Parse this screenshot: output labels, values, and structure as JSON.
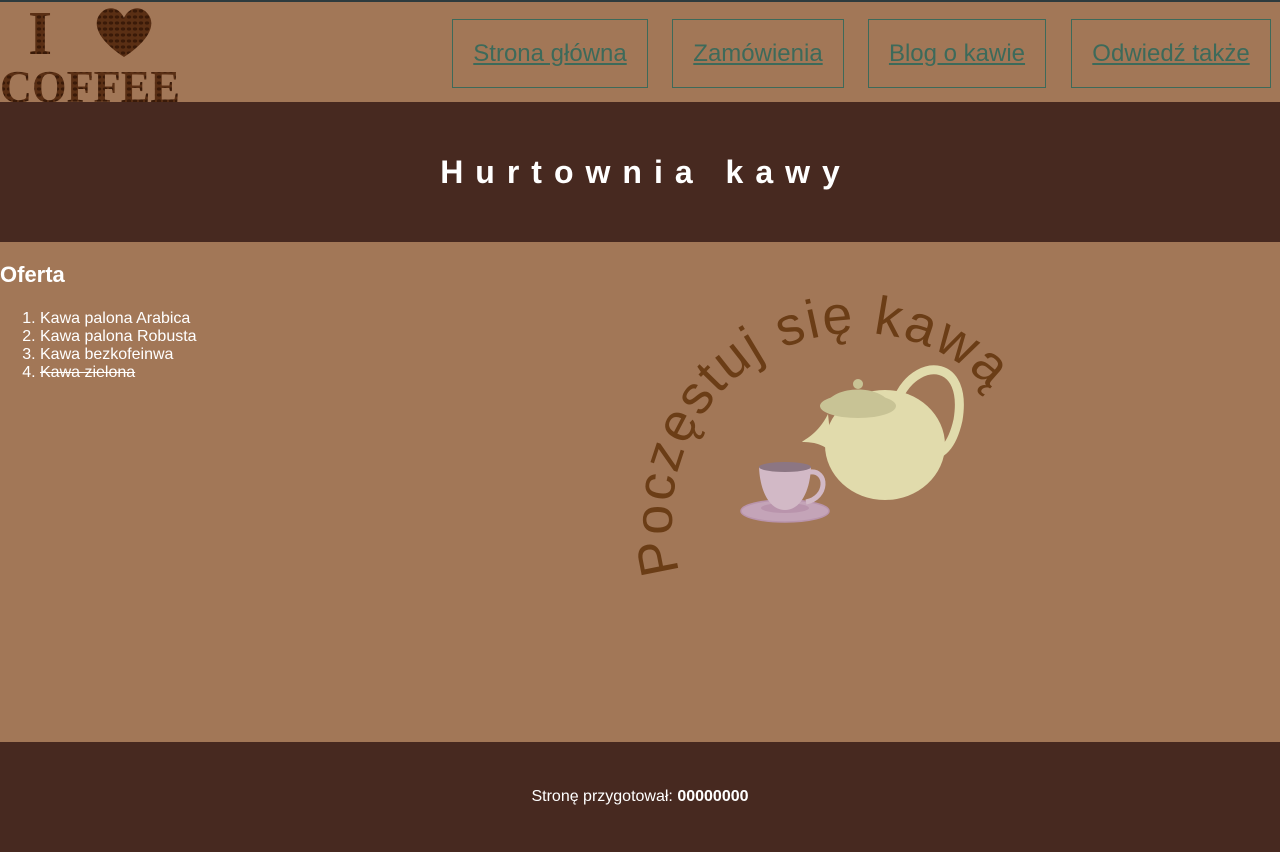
{
  "logo": {
    "line1": "I",
    "line2": "COFFEE",
    "icon": "heart-icon"
  },
  "nav": {
    "items": [
      {
        "label": "Strona główna"
      },
      {
        "label": "Zamówienia"
      },
      {
        "label": "Blog o kawie"
      },
      {
        "label": "Odwiedź także"
      }
    ]
  },
  "banner": {
    "title": "Hurtownia kawy"
  },
  "offer": {
    "heading": "Oferta",
    "items": [
      {
        "label": "Kawa palona Arabica"
      },
      {
        "label": "Kawa palona Robusta"
      },
      {
        "label": "Kawa bezkofeinwa"
      },
      {
        "label": "Kawa zielona"
      }
    ]
  },
  "illustration": {
    "arc_text": "Poczęstuj się kawą",
    "icons": [
      "teapot-icon",
      "teacup-icon"
    ]
  },
  "footer": {
    "prefix": "Stronę przygotował: ",
    "author": "00000000"
  },
  "colors": {
    "page_bg": "#A27757",
    "dark_band": "#472920",
    "nav_accent": "#3D6A5A",
    "arc_text": "#6B3D16"
  }
}
